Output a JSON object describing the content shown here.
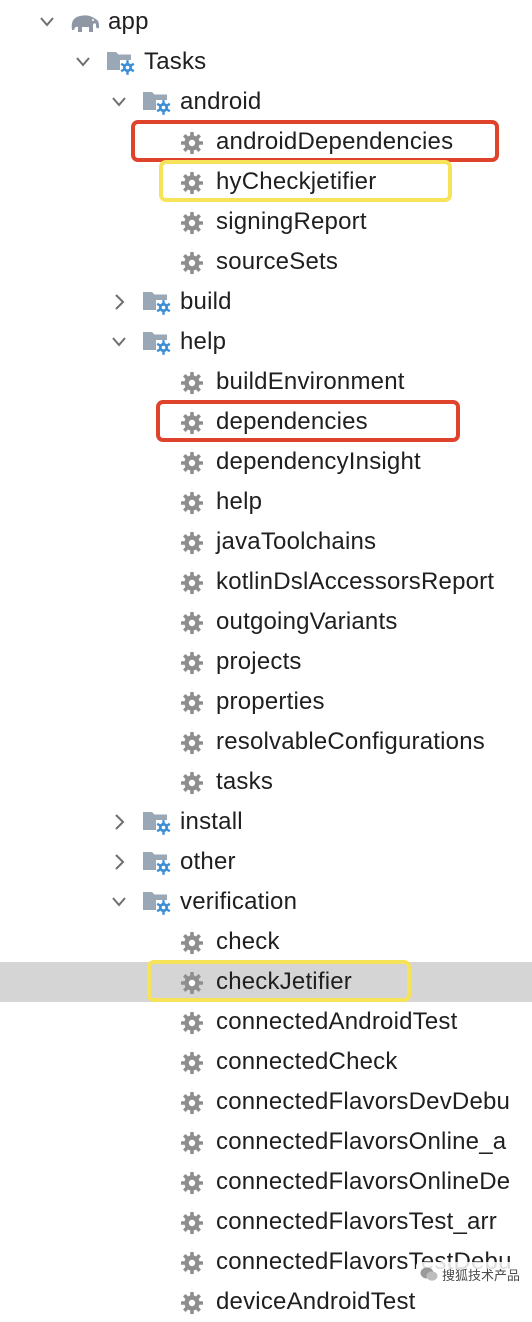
{
  "tree": [
    {
      "label": "app",
      "kind": "module",
      "level": 0,
      "expanded": true
    },
    {
      "label": "Tasks",
      "kind": "folder",
      "level": 1,
      "expanded": true
    },
    {
      "label": "android",
      "kind": "folder",
      "level": 2,
      "expanded": true
    },
    {
      "label": "androidDependencies",
      "kind": "task",
      "level": 3,
      "highlight": "red"
    },
    {
      "label": "hyCheckjetifier",
      "kind": "task",
      "level": 3,
      "highlight": "yellow"
    },
    {
      "label": "signingReport",
      "kind": "task",
      "level": 3
    },
    {
      "label": "sourceSets",
      "kind": "task",
      "level": 3
    },
    {
      "label": "build",
      "kind": "folder",
      "level": 2,
      "expanded": false
    },
    {
      "label": "help",
      "kind": "folder",
      "level": 2,
      "expanded": true
    },
    {
      "label": "buildEnvironment",
      "kind": "task",
      "level": 3
    },
    {
      "label": "dependencies",
      "kind": "task",
      "level": 3,
      "highlight": "red"
    },
    {
      "label": "dependencyInsight",
      "kind": "task",
      "level": 3
    },
    {
      "label": "help",
      "kind": "task",
      "level": 3
    },
    {
      "label": "javaToolchains",
      "kind": "task",
      "level": 3
    },
    {
      "label": "kotlinDslAccessorsReport",
      "kind": "task",
      "level": 3
    },
    {
      "label": "outgoingVariants",
      "kind": "task",
      "level": 3
    },
    {
      "label": "projects",
      "kind": "task",
      "level": 3
    },
    {
      "label": "properties",
      "kind": "task",
      "level": 3
    },
    {
      "label": "resolvableConfigurations",
      "kind": "task",
      "level": 3
    },
    {
      "label": "tasks",
      "kind": "task",
      "level": 3
    },
    {
      "label": "install",
      "kind": "folder",
      "level": 2,
      "expanded": false
    },
    {
      "label": "other",
      "kind": "folder",
      "level": 2,
      "expanded": false
    },
    {
      "label": "verification",
      "kind": "folder",
      "level": 2,
      "expanded": true
    },
    {
      "label": "check",
      "kind": "task",
      "level": 3
    },
    {
      "label": "checkJetifier",
      "kind": "task",
      "level": 3,
      "highlight": "yellow",
      "selected": true
    },
    {
      "label": "connectedAndroidTest",
      "kind": "task",
      "level": 3
    },
    {
      "label": "connectedCheck",
      "kind": "task",
      "level": 3
    },
    {
      "label": "connectedFlavorsDevDebu",
      "kind": "task",
      "level": 3
    },
    {
      "label": "connectedFlavorsOnline_a",
      "kind": "task",
      "level": 3
    },
    {
      "label": "connectedFlavorsOnlineDe",
      "kind": "task",
      "level": 3
    },
    {
      "label": "connectedFlavorsTest_arr",
      "kind": "task",
      "level": 3
    },
    {
      "label": "connectedFlavorsTestDebu",
      "kind": "task",
      "level": 3
    },
    {
      "label": "deviceAndroidTest",
      "kind": "task",
      "level": 3
    }
  ],
  "watermark": {
    "text": "搜狐技术产品"
  },
  "colors": {
    "highlight_red": "#e0432b",
    "highlight_yellow": "#f6e35a",
    "selection": "#d5d5d5",
    "gear": "#8e8e8e",
    "folder": "#9aa7b4",
    "folder_gear": "#3e8fd6"
  },
  "icons": {
    "expanded": "chevron-down-icon",
    "collapsed": "chevron-right-icon",
    "module": "elephant-icon",
    "folder": "folder-gear-icon",
    "task": "gear-icon"
  }
}
